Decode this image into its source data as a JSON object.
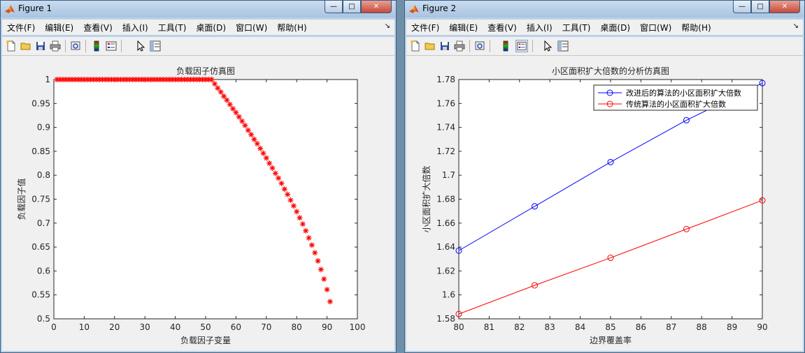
{
  "windows": [
    {
      "title": "Figure 1",
      "menu": [
        "文件(F)",
        "编辑(E)",
        "查看(V)",
        "插入(I)",
        "工具(T)",
        "桌面(D)",
        "窗口(W)",
        "帮助(H)"
      ]
    },
    {
      "title": "Figure 2",
      "menu": [
        "文件(F)",
        "编辑(E)",
        "查看(V)",
        "插入(I)",
        "工具(T)",
        "桌面(D)",
        "窗口(W)",
        "帮助(H)"
      ]
    }
  ],
  "toolbar_icons": [
    "new-file-icon",
    "open-folder-icon",
    "save-icon",
    "print-icon",
    "print-preview-icon",
    "colorbar-icon",
    "legend-icon",
    "pointer-icon",
    "property-editor-icon"
  ],
  "window_buttons": {
    "minimize": "—",
    "maximize": "□",
    "close": "✕"
  },
  "chart_data": [
    {
      "type": "scatter",
      "title": "负载因子仿真图",
      "xlabel": "负载因子变量",
      "ylabel": "负载因子值",
      "xlim": [
        0,
        100
      ],
      "ylim": [
        0.5,
        1
      ],
      "xticks": [
        "0",
        "10",
        "20",
        "30",
        "40",
        "50",
        "60",
        "70",
        "80",
        "90",
        "100"
      ],
      "yticks": [
        "0.5",
        "0.55",
        "0.6",
        "0.65",
        "0.7",
        "0.75",
        "0.8",
        "0.85",
        "0.9",
        "0.95",
        "1"
      ],
      "marker": "*",
      "color": "#ff0000",
      "grid": false,
      "x": [
        1,
        2,
        3,
        4,
        5,
        6,
        7,
        8,
        9,
        10,
        11,
        12,
        13,
        14,
        15,
        16,
        17,
        18,
        19,
        20,
        21,
        22,
        23,
        24,
        25,
        26,
        27,
        28,
        29,
        30,
        31,
        32,
        33,
        34,
        35,
        36,
        37,
        38,
        39,
        40,
        41,
        42,
        43,
        44,
        45,
        46,
        47,
        48,
        49,
        50,
        51,
        52,
        53,
        54,
        55,
        56,
        57,
        58,
        59,
        60,
        61,
        62,
        63,
        64,
        65,
        66,
        67,
        68,
        69,
        70,
        71,
        72,
        73,
        74,
        75,
        76,
        77,
        78,
        79,
        80,
        81,
        82,
        83,
        84,
        85,
        86,
        87,
        88,
        89,
        90,
        91
      ],
      "y": [
        1,
        1,
        1,
        1,
        1,
        1,
        1,
        1,
        1,
        1,
        1,
        1,
        1,
        1,
        1,
        1,
        1,
        1,
        1,
        1,
        1,
        1,
        1,
        1,
        1,
        1,
        1,
        1,
        1,
        1,
        1,
        1,
        1,
        1,
        1,
        1,
        1,
        1,
        1,
        1,
        1,
        1,
        1,
        1,
        1,
        1,
        1,
        1,
        1,
        1,
        1,
        1,
        0.991,
        0.982,
        0.974,
        0.965,
        0.957,
        0.948,
        0.939,
        0.931,
        0.922,
        0.913,
        0.904,
        0.894,
        0.885,
        0.875,
        0.866,
        0.856,
        0.846,
        0.836,
        0.825,
        0.815,
        0.804,
        0.794,
        0.783,
        0.771,
        0.76,
        0.748,
        0.736,
        0.724,
        0.711,
        0.698,
        0.684,
        0.669,
        0.654,
        0.638,
        0.621,
        0.603,
        0.583,
        0.561,
        0.536,
        0.517
      ]
    },
    {
      "type": "line",
      "title": "小区面积扩大倍数的分析仿真图",
      "xlabel": "边界覆盖率",
      "ylabel": "小区面积扩大倍数",
      "xlim": [
        80,
        90
      ],
      "ylim": [
        1.58,
        1.78
      ],
      "xticks": [
        "80",
        "81",
        "82",
        "83",
        "84",
        "85",
        "86",
        "87",
        "88",
        "89",
        "90"
      ],
      "yticks": [
        "1.58",
        "1.6",
        "1.62",
        "1.64",
        "1.66",
        "1.68",
        "1.7",
        "1.72",
        "1.74",
        "1.76",
        "1.78"
      ],
      "legend_position": "top-right",
      "grid": false,
      "x": [
        80,
        82.5,
        85,
        87.5,
        90
      ],
      "series": [
        {
          "name": "改进后的算法的小区面积扩大倍数",
          "color": "#0000ff",
          "values": [
            1.637,
            1.674,
            1.711,
            1.746,
            1.777
          ]
        },
        {
          "name": "传统算法的小区面积扩大倍数",
          "color": "#ff0000",
          "values": [
            1.584,
            1.608,
            1.631,
            1.655,
            1.679
          ]
        }
      ]
    }
  ]
}
